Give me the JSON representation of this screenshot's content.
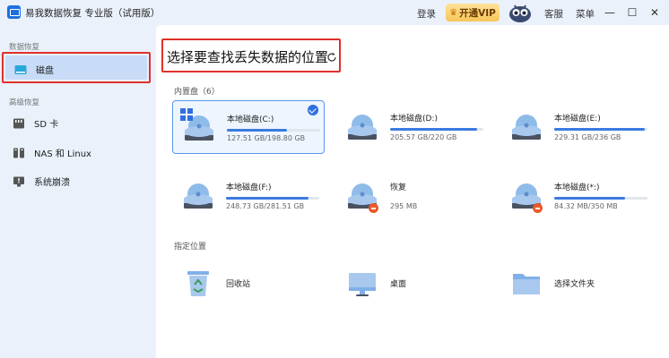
{
  "titlebar": {
    "app_title": "易我数据恢复 专业版（试用版）",
    "login": "登录",
    "vip": "开通VIP",
    "service": "客服",
    "menu": "菜单",
    "min": "—",
    "max": "☐",
    "close": "✕"
  },
  "sidebar": {
    "section_recovery": "数据恢复",
    "disk": "磁盘",
    "section_advanced": "高级恢复",
    "sd": "SD 卡",
    "nas": "NAS 和 Linux",
    "crash": "系统崩溃"
  },
  "main": {
    "title": "选择要查找丢失数据的位置",
    "group_internal": "内置盘（6）",
    "group_location": "指定位置",
    "drives": [
      {
        "name": "本地磁盘(C:)",
        "size": "127.51 GB/198.80 GB",
        "used": 0.64
      },
      {
        "name": "本地磁盘(D:)",
        "size": "205.57 GB/220 GB",
        "used": 0.93
      },
      {
        "name": "本地磁盘(E:)",
        "size": "229.31 GB/236 GB",
        "used": 0.97
      },
      {
        "name": "本地磁盘(F:)",
        "size": "248.73 GB/281.51 GB",
        "used": 0.88
      },
      {
        "name": "恢复",
        "size": "295 MB",
        "used": 0.0
      },
      {
        "name": "本地磁盘(*:)",
        "size": "84.32 MB/350 MB",
        "used": 0.76
      }
    ],
    "locations": [
      {
        "name": "回收站"
      },
      {
        "name": "桌面"
      },
      {
        "name": "选择文件夹"
      }
    ]
  },
  "colors": {
    "accent": "#2f6fe0",
    "highlight": "#e0302a",
    "sidebar_bg": "#eaf1fb"
  }
}
